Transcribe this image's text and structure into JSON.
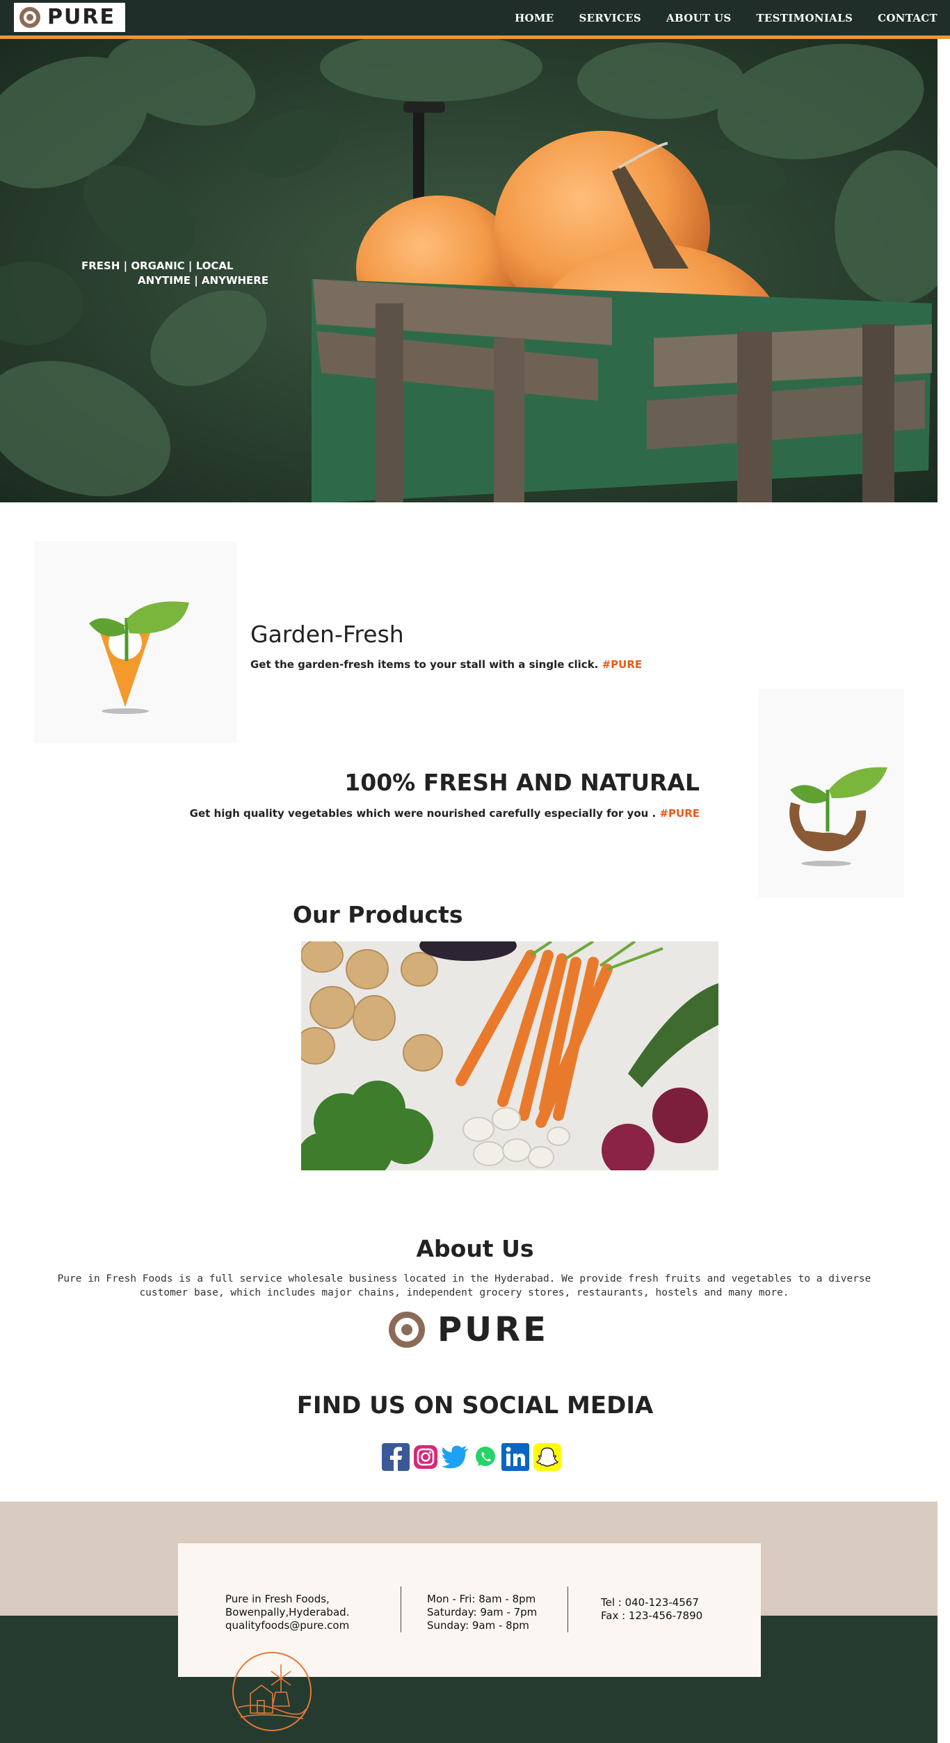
{
  "brand": {
    "name": "PURE"
  },
  "nav": {
    "items": [
      "HOME",
      "SERVICES",
      "ABOUT US",
      "TESTIMONIALS",
      "CONTACT"
    ]
  },
  "hero": {
    "tagline_line1": "FRESH | ORGANIC | LOCAL",
    "tagline_line2": "ANYTIME | ANYWHERE"
  },
  "features": [
    {
      "title": "Garden-Fresh",
      "description": "Get the garden-fresh items to your stall with a single click.",
      "hashtag": "#PURE"
    },
    {
      "title": "100% FRESH AND NATURAL",
      "description": "Get high quality vegetables which were nourished carefully especially for you .",
      "hashtag": "#PURE"
    }
  ],
  "products": {
    "title": "Our Products"
  },
  "about": {
    "title": "About Us",
    "text": "Pure in Fresh Foods is a full service wholesale business located in the Hyderabad. We provide fresh fruits and vegetables to a diverse customer base, which includes major chains, independent grocery stores, restaurants, hostels and many more."
  },
  "social": {
    "title": "FIND US ON SOCIAL MEDIA",
    "icons": [
      "facebook-icon",
      "instagram-icon",
      "twitter-icon",
      "whatsapp-icon",
      "linkedin-icon",
      "snapchat-icon"
    ]
  },
  "footer": {
    "address": [
      "Pure in Fresh Foods,",
      "Bowenpally,Hyderabad.",
      "qualityfoods@pure.com"
    ],
    "hours": [
      "Mon - Fri: 8am - 8pm",
      "Saturday: 9am - 7pm",
      "Sunday: 9am - 8pm"
    ],
    "contact": [
      "Tel : 040-123-4567",
      "Fax : 123-456-7890"
    ]
  },
  "colors": {
    "nav_bg": "#1f2e28",
    "accent_orange": "#f0962f",
    "hashtag": "#e85a1c",
    "footer_beige": "#d9cbbf",
    "footer_dark": "#263b2f",
    "logo_brown": "#8b6b58"
  }
}
